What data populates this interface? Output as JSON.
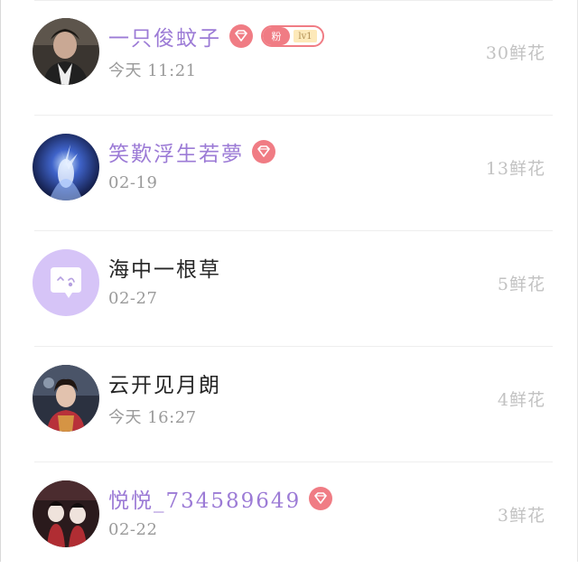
{
  "rows": [
    {
      "name": "一只俊蚊子",
      "vip": true,
      "diamond": "diamond-badge",
      "fan_badge": {
        "label": "粉",
        "level": "lv1"
      },
      "date": "今天 11:21",
      "count": "30鲜花",
      "avatar": "user-photo"
    },
    {
      "name": "笑歎浮生若夢",
      "vip": true,
      "diamond": "diamond-badge",
      "date": "02-19",
      "count": "13鲜花",
      "avatar": "user-photo"
    },
    {
      "name": "海中一根草",
      "vip": false,
      "date": "02-27",
      "count": "5鲜花",
      "avatar": "default-chat-avatar"
    },
    {
      "name": "云开见月朗",
      "vip": false,
      "date": "今天 16:27",
      "count": "4鲜花",
      "avatar": "user-photo"
    },
    {
      "name": "悦悦_734589649",
      "vip": true,
      "diamond": "diamond-badge",
      "date": "02-22",
      "count": "3鲜花",
      "avatar": "user-photo"
    }
  ],
  "colors": {
    "vip_name": "#9c7bd6",
    "normal_name": "#262626",
    "badge_red": "#f07c84",
    "date_gray": "#9a9a9a",
    "count_gray": "#c2c2c2",
    "default_avatar": "#d6c4f7"
  }
}
